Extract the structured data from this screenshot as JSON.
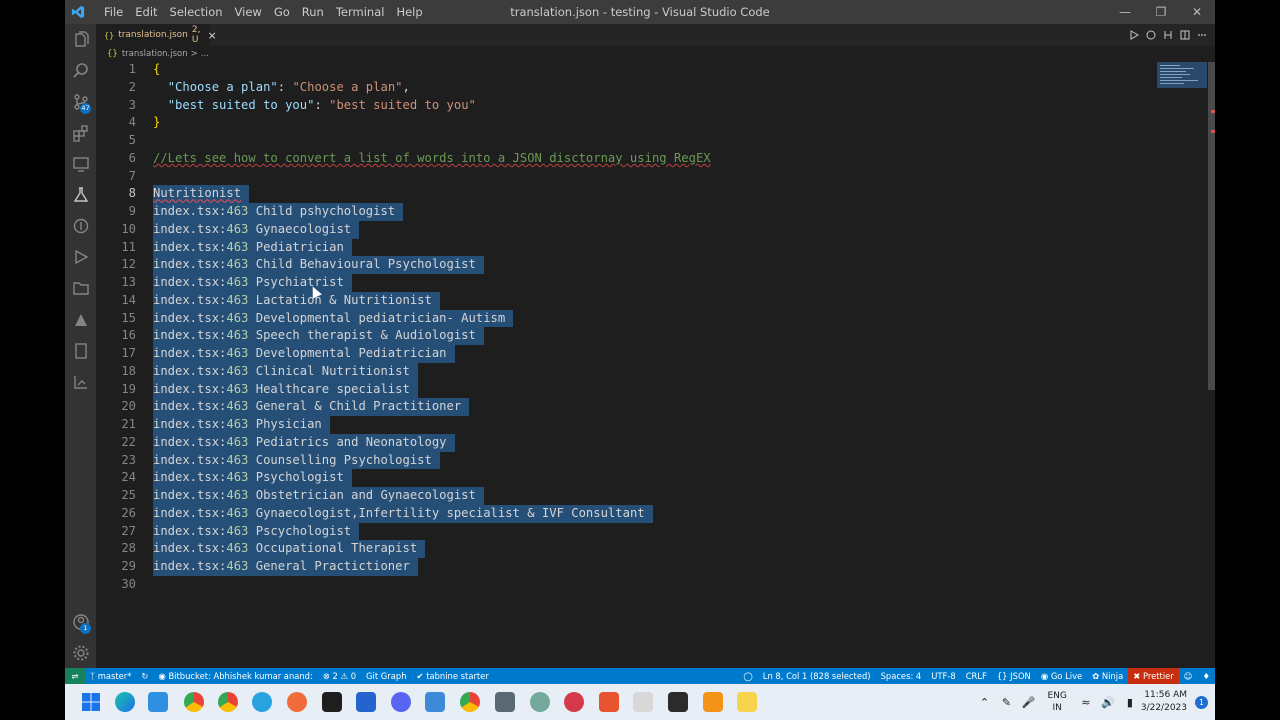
{
  "titlebar": {
    "menu": [
      "File",
      "Edit",
      "Selection",
      "View",
      "Go",
      "Run",
      "Terminal",
      "Help"
    ],
    "title": "translation.json - testing - Visual Studio Code"
  },
  "activity_bar": {
    "items": [
      "explorer-icon",
      "search-icon",
      "source-control-icon",
      "extensions-icon",
      "remote-explorer-icon",
      "testing-icon",
      "git-graph-icon",
      "run-debug-icon",
      "folder-icon",
      "tabnine-icon",
      "notes-icon",
      "live-share-icon"
    ],
    "source_control_badge": "47",
    "accounts_badge": "1"
  },
  "tab": {
    "label": "translation.json",
    "status": "2, U"
  },
  "breadcrumb": {
    "file": "translation.json",
    "separator": ">",
    "more": "..."
  },
  "editor": {
    "active_line": 8,
    "lines": [
      {
        "n": "1",
        "parts": [
          {
            "t": "{",
            "c": "brk"
          }
        ]
      },
      {
        "n": "2",
        "parts": [
          {
            "t": "  ",
            "c": "punc"
          },
          {
            "t": "\"Choose a plan\"",
            "c": "key"
          },
          {
            "t": ": ",
            "c": "punc"
          },
          {
            "t": "\"Choose a plan\"",
            "c": "str"
          },
          {
            "t": ",",
            "c": "punc"
          }
        ]
      },
      {
        "n": "3",
        "parts": [
          {
            "t": "  ",
            "c": "punc"
          },
          {
            "t": "\"best suited to you\"",
            "c": "key"
          },
          {
            "t": ": ",
            "c": "punc"
          },
          {
            "t": "\"best suited to you\"",
            "c": "str"
          }
        ]
      },
      {
        "n": "4",
        "parts": [
          {
            "t": "}",
            "c": "brk"
          }
        ]
      },
      {
        "n": "5",
        "parts": []
      },
      {
        "n": "6",
        "parts": [
          {
            "t": "//Lets see how to convert a list of words into a JSON disctornay using RegEX",
            "c": "cmt"
          }
        ]
      },
      {
        "n": "7",
        "parts": []
      },
      {
        "n": "8",
        "sel": true,
        "parts": [
          {
            "t": "Nutritionist",
            "c": "err-u"
          }
        ]
      },
      {
        "n": "9",
        "sel": true,
        "parts": [
          {
            "t": "index.tsx:",
            "c": "punc"
          },
          {
            "t": "463",
            "c": "num"
          },
          {
            "t": " Child pshychologist",
            "c": "punc"
          }
        ]
      },
      {
        "n": "10",
        "sel": true,
        "parts": [
          {
            "t": "index.tsx:",
            "c": "punc"
          },
          {
            "t": "463",
            "c": "num"
          },
          {
            "t": " Gynaecologist",
            "c": "punc"
          }
        ]
      },
      {
        "n": "11",
        "sel": true,
        "parts": [
          {
            "t": "index.tsx:",
            "c": "punc"
          },
          {
            "t": "463",
            "c": "num"
          },
          {
            "t": " Pediatrician",
            "c": "punc"
          }
        ]
      },
      {
        "n": "12",
        "sel": true,
        "parts": [
          {
            "t": "index.tsx:",
            "c": "punc"
          },
          {
            "t": "463",
            "c": "num"
          },
          {
            "t": " Child Behavioural Psychologist",
            "c": "punc"
          }
        ]
      },
      {
        "n": "13",
        "sel": true,
        "parts": [
          {
            "t": "index.tsx:",
            "c": "punc"
          },
          {
            "t": "463",
            "c": "num"
          },
          {
            "t": " Psychiatrist",
            "c": "punc"
          }
        ]
      },
      {
        "n": "14",
        "sel": true,
        "parts": [
          {
            "t": "index.tsx:",
            "c": "punc"
          },
          {
            "t": "463",
            "c": "num"
          },
          {
            "t": " Lactation & Nutritionist",
            "c": "punc"
          }
        ]
      },
      {
        "n": "15",
        "sel": true,
        "parts": [
          {
            "t": "index.tsx:",
            "c": "punc"
          },
          {
            "t": "463",
            "c": "num"
          },
          {
            "t": " Developmental pediatrician- Autism",
            "c": "punc"
          }
        ]
      },
      {
        "n": "16",
        "sel": true,
        "parts": [
          {
            "t": "index.tsx:",
            "c": "punc"
          },
          {
            "t": "463",
            "c": "num"
          },
          {
            "t": " Speech therapist & Audiologist",
            "c": "punc"
          }
        ]
      },
      {
        "n": "17",
        "sel": true,
        "parts": [
          {
            "t": "index.tsx:",
            "c": "punc"
          },
          {
            "t": "463",
            "c": "num"
          },
          {
            "t": " Developmental Pediatrician",
            "c": "punc"
          }
        ]
      },
      {
        "n": "18",
        "sel": true,
        "parts": [
          {
            "t": "index.tsx:",
            "c": "punc"
          },
          {
            "t": "463",
            "c": "num"
          },
          {
            "t": " Clinical Nutritionist",
            "c": "punc"
          }
        ]
      },
      {
        "n": "19",
        "sel": true,
        "parts": [
          {
            "t": "index.tsx:",
            "c": "punc"
          },
          {
            "t": "463",
            "c": "num"
          },
          {
            "t": " Healthcare specialist",
            "c": "punc"
          }
        ]
      },
      {
        "n": "20",
        "sel": true,
        "parts": [
          {
            "t": "index.tsx:",
            "c": "punc"
          },
          {
            "t": "463",
            "c": "num"
          },
          {
            "t": " General & Child Practitioner",
            "c": "punc"
          }
        ]
      },
      {
        "n": "21",
        "sel": true,
        "parts": [
          {
            "t": "index.tsx:",
            "c": "punc"
          },
          {
            "t": "463",
            "c": "num"
          },
          {
            "t": " Physician",
            "c": "punc"
          }
        ]
      },
      {
        "n": "22",
        "sel": true,
        "parts": [
          {
            "t": "index.tsx:",
            "c": "punc"
          },
          {
            "t": "463",
            "c": "num"
          },
          {
            "t": " Pediatrics and Neonatology",
            "c": "punc"
          }
        ]
      },
      {
        "n": "23",
        "sel": true,
        "parts": [
          {
            "t": "index.tsx:",
            "c": "punc"
          },
          {
            "t": "463",
            "c": "num"
          },
          {
            "t": " Counselling Psychologist",
            "c": "punc"
          }
        ]
      },
      {
        "n": "24",
        "sel": true,
        "parts": [
          {
            "t": "index.tsx:",
            "c": "punc"
          },
          {
            "t": "463",
            "c": "num"
          },
          {
            "t": " Psychologist",
            "c": "punc"
          }
        ]
      },
      {
        "n": "25",
        "sel": true,
        "parts": [
          {
            "t": "index.tsx:",
            "c": "punc"
          },
          {
            "t": "463",
            "c": "num"
          },
          {
            "t": " Obstetrician and Gynaecologist",
            "c": "punc"
          }
        ]
      },
      {
        "n": "26",
        "sel": true,
        "parts": [
          {
            "t": "index.tsx:",
            "c": "punc"
          },
          {
            "t": "463",
            "c": "num"
          },
          {
            "t": " Gynaecologist,Infertility specialist & IVF Consultant",
            "c": "punc"
          }
        ]
      },
      {
        "n": "27",
        "sel": true,
        "parts": [
          {
            "t": "index.tsx:",
            "c": "punc"
          },
          {
            "t": "463",
            "c": "num"
          },
          {
            "t": " Pscychologist",
            "c": "punc"
          }
        ]
      },
      {
        "n": "28",
        "sel": true,
        "parts": [
          {
            "t": "index.tsx:",
            "c": "punc"
          },
          {
            "t": "463",
            "c": "num"
          },
          {
            "t": " Occupational Therapist",
            "c": "punc"
          }
        ]
      },
      {
        "n": "29",
        "sel": true,
        "parts": [
          {
            "t": "index.tsx:",
            "c": "punc"
          },
          {
            "t": "463",
            "c": "num"
          },
          {
            "t": " General Practictioner",
            "c": "punc"
          }
        ]
      },
      {
        "n": "30",
        "parts": []
      }
    ]
  },
  "statusbar": {
    "branch": "master*",
    "bitbucket": "Bitbucket: Abhishek kumar anand:",
    "problems": "2",
    "warnings": "0",
    "git_graph": "Git Graph",
    "tabnine": "tabnine starter",
    "cursor_pos": "Ln 8, Col 1 (828 selected)",
    "spaces": "Spaces: 4",
    "encoding": "UTF-8",
    "eol": "CRLF",
    "language": "JSON",
    "go_live": "Go Live",
    "ninja": "Ninja",
    "prettier": "Prettier"
  },
  "taskbar": {
    "apps": [
      "windows-start-icon",
      "edge-icon",
      "vscode-icon",
      "chrome-icon",
      "chrome-profile-icon",
      "telegram-icon",
      "postman-icon",
      "figma-icon",
      "todo-icon",
      "discord-icon",
      "notepad-icon",
      "chrome-alt-icon",
      "calculator-icon",
      "chatgpt-icon",
      "gitkraken-icon",
      "canva-icon",
      "wsl-icon",
      "terminal-icon",
      "vlc-icon",
      "sticky-notes-icon"
    ],
    "lang_top": "ENG",
    "lang_bottom": "IN",
    "time": "11:56 AM",
    "date": "3/22/2023",
    "notifications": "1"
  },
  "colors": {
    "editor_bg": "#1e1e1e",
    "selection": "#264f78",
    "statusbar": "#007acc",
    "prettier_bg": "#c72e0f",
    "string": "#ce9178",
    "key": "#9cdcfe",
    "comment": "#6a9955",
    "number": "#b5cea8"
  }
}
